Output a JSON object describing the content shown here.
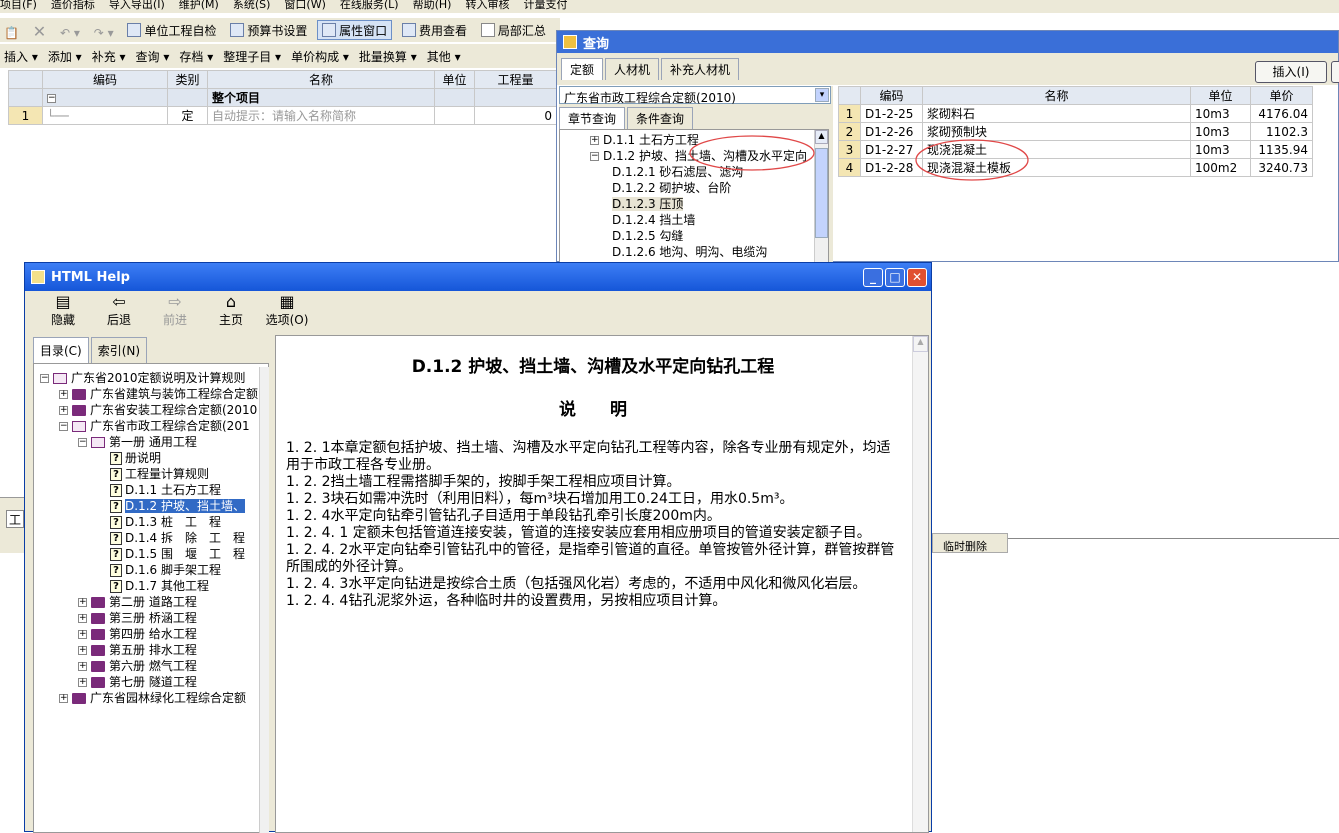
{
  "menubar": [
    "项目(F)",
    "造价指标",
    "导入导出(I)",
    "维护(M)",
    "系统(S)",
    "窗口(W)",
    "在线服务(L)",
    "帮助(H)",
    "转入审核",
    "计量支付"
  ],
  "toolbar1": {
    "unit_check": "单位工程自检",
    "budget_settings": "预算书设置",
    "property_window": "属性窗口",
    "fee_view": "费用查看",
    "local_summary": "局部汇总"
  },
  "toolbar2": [
    "插入 ▾",
    "添加 ▾",
    "补充 ▾",
    "查询 ▾",
    "存档 ▾",
    "整理子目 ▾",
    "单价构成 ▾",
    "批量换算 ▾",
    "其他 ▾"
  ],
  "main_grid": {
    "headers": [
      "编码",
      "类别",
      "名称",
      "单位",
      "工程量"
    ],
    "group_row": {
      "marker": "−",
      "name": "整个项目"
    },
    "row1": {
      "index": "1",
      "type": "定",
      "name_placeholder": "自动提示：请输入名称简称",
      "quantity": "0"
    }
  },
  "query_window": {
    "title": "查询",
    "tabs": [
      "定额",
      "人材机",
      "补充人材机"
    ],
    "insert_button": "插入(I)",
    "quota_select": "广东省市政工程综合定额(2010)",
    "subtabs": [
      "章节查询",
      "条件查询"
    ],
    "tree": [
      {
        "label": "D.1.1 土石方工程",
        "level": 1,
        "expander": "+"
      },
      {
        "label": "D.1.2 护坡、挡土墙、沟槽及水平定向",
        "level": 1,
        "expander": "−"
      },
      {
        "label": "D.1.2.1 砂石滤层、滤沟",
        "level": 2
      },
      {
        "label": "D.1.2.2 砌护坡、台阶",
        "level": 2
      },
      {
        "label": "D.1.2.3 压顶",
        "level": 2,
        "selected": true
      },
      {
        "label": "D.1.2.4 挡土墙",
        "level": 2
      },
      {
        "label": "D.1.2.5 勾缝",
        "level": 2
      },
      {
        "label": "D.1.2.6 地沟、明沟、电缆沟",
        "level": 2
      }
    ],
    "result_headers": [
      "编码",
      "名称",
      "单位",
      "单价"
    ],
    "results": [
      {
        "idx": "1",
        "code": "D1-2-25",
        "name": "浆砌料石",
        "unit": "10m3",
        "price": "4176.04"
      },
      {
        "idx": "2",
        "code": "D1-2-26",
        "name": "浆砌预制块",
        "unit": "10m3",
        "price": "1102.3"
      },
      {
        "idx": "3",
        "code": "D1-2-27",
        "name": "现浇混凝土",
        "unit": "10m3",
        "price": "1135.94"
      },
      {
        "idx": "4",
        "code": "D1-2-28",
        "name": "现浇混凝土模板",
        "unit": "100m2",
        "price": "3240.73"
      }
    ]
  },
  "bg_fragment": "临时删除",
  "bg_fragment2": "工",
  "help_window": {
    "title": "HTML Help",
    "toolbar": [
      "隐藏",
      "后退",
      "前进",
      "主页",
      "选项(O)"
    ],
    "tabs": [
      "目录(C)",
      "索引(N)"
    ],
    "tree": [
      {
        "label": "广东省2010定额说明及计算规则",
        "level": 0,
        "exp": "−",
        "icon": "obook"
      },
      {
        "label": "广东省建筑与装饰工程综合定额",
        "level": 1,
        "exp": "+",
        "icon": "book"
      },
      {
        "label": "广东省安装工程综合定额(2010",
        "level": 1,
        "exp": "+",
        "icon": "book"
      },
      {
        "label": "广东省市政工程综合定额(201",
        "level": 1,
        "exp": "−",
        "icon": "obook"
      },
      {
        "label": "第一册 通用工程",
        "level": 2,
        "exp": "−",
        "icon": "obook"
      },
      {
        "label": "册说明",
        "level": 3,
        "icon": "q"
      },
      {
        "label": "工程量计算规则",
        "level": 3,
        "icon": "q"
      },
      {
        "label": "D.1.1  土石方工程",
        "level": 3,
        "icon": "q"
      },
      {
        "label": "D.1.2  护坡、挡土墙、",
        "level": 3,
        "icon": "q",
        "selected": true
      },
      {
        "label": "D.1.3  桩　工　程",
        "level": 3,
        "icon": "q"
      },
      {
        "label": "D.1.4  拆　除　工　程",
        "level": 3,
        "icon": "q"
      },
      {
        "label": "D.1.5  围　堰　工　程",
        "level": 3,
        "icon": "q"
      },
      {
        "label": "D.1.6  脚手架工程",
        "level": 3,
        "icon": "q"
      },
      {
        "label": "D.1.7  其他工程",
        "level": 3,
        "icon": "q"
      },
      {
        "label": "第二册 道路工程",
        "level": 2,
        "exp": "+",
        "icon": "book"
      },
      {
        "label": "第三册 桥涵工程",
        "level": 2,
        "exp": "+",
        "icon": "book"
      },
      {
        "label": "第四册 给水工程",
        "level": 2,
        "exp": "+",
        "icon": "book"
      },
      {
        "label": "第五册 排水工程",
        "level": 2,
        "exp": "+",
        "icon": "book"
      },
      {
        "label": "第六册 燃气工程",
        "level": 2,
        "exp": "+",
        "icon": "book"
      },
      {
        "label": "第七册 隧道工程",
        "level": 2,
        "exp": "+",
        "icon": "book"
      },
      {
        "label": "广东省园林绿化工程综合定额",
        "level": 1,
        "exp": "+",
        "icon": "book"
      }
    ],
    "content": {
      "heading": "D.1.2  护坡、挡土墙、沟槽及水平定向钻孔工程",
      "subheading": "说　　明",
      "paragraphs": [
        "1. 2. 1本章定额包括护坡、挡土墙、沟槽及水平定向钻孔工程等内容，除各专业册有规定外，均适用于市政工程各专业册。",
        "1. 2. 2挡土墙工程需搭脚手架的，按脚手架工程相应项目计算。",
        "1. 2. 3块石如需冲洗时（利用旧料），每m³块石增加用工0.24工日，用水0.5m³。",
        "1. 2. 4水平定向钻牵引管钻孔子目适用于单段钻孔牵引长度200m内。",
        "1. 2. 4. 1  定额未包括管道连接安装，管道的连接安装应套用相应册项目的管道安装定额子目。",
        "1. 2. 4. 2水平定向钻牵引管钻孔中的管径，是指牵引管道的直径。单管按管外径计算，群管按群管所围成的外径计算。",
        "1. 2. 4. 3水平定向钻进是按综合土质（包括强风化岩）考虑的，不适用中风化和微风化岩层。",
        "1. 2. 4. 4钻孔泥浆外运，各种临时井的设置费用，另按相应项目计算。"
      ]
    }
  }
}
